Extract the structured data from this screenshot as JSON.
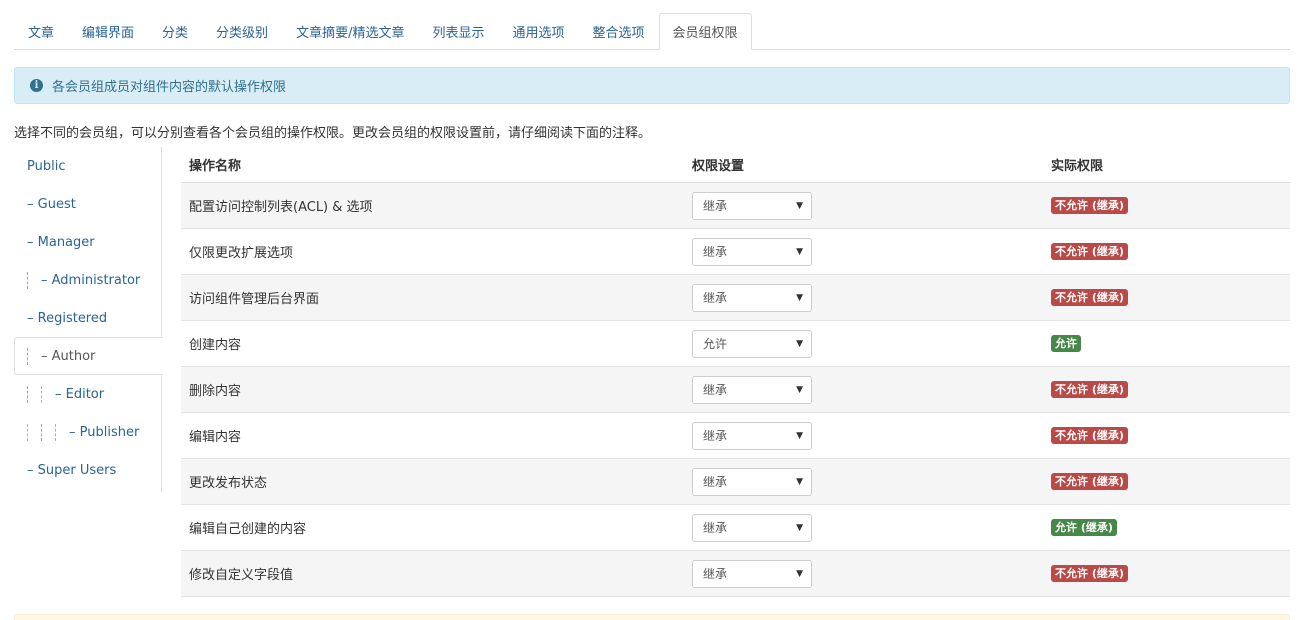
{
  "tabs": [
    "文章",
    "编辑界面",
    "分类",
    "分类级别",
    "文章摘要/精选文章",
    "列表显示",
    "通用选项",
    "整合选项",
    "会员组权限"
  ],
  "active_tab": 8,
  "alert": {
    "icon": "info-icon",
    "text": "各会员组成员对组件内容的默认操作权限"
  },
  "intro": "选择不同的会员组，可以分别查看各个会员组的操作权限。更改会员组的权限设置前，请仔细阅读下面的注释。",
  "groups": [
    "Public",
    "– Guest",
    "– Manager",
    "– Administrator",
    "– Registered",
    "– Author",
    "– Editor",
    "– Publisher",
    "– Super Users"
  ],
  "table": {
    "headers": [
      "操作名称",
      "权限设置",
      "实际权限"
    ],
    "rows": [
      {
        "action": "配置访问控制列表(ACL) & 选项",
        "setting": "继承",
        "result": "不允许 (继承)",
        "status": "deny"
      },
      {
        "action": "仅限更改扩展选项",
        "setting": "继承",
        "result": "不允许 (继承)",
        "status": "deny"
      },
      {
        "action": "访问组件管理后台界面",
        "setting": "继承",
        "result": "不允许 (继承)",
        "status": "deny"
      },
      {
        "action": "创建内容",
        "setting": "允许",
        "result": "允许",
        "status": "allow"
      },
      {
        "action": "删除内容",
        "setting": "继承",
        "result": "不允许 (继承)",
        "status": "deny"
      },
      {
        "action": "编辑内容",
        "setting": "继承",
        "result": "不允许 (继承)",
        "status": "deny"
      },
      {
        "action": "更改发布状态",
        "setting": "继承",
        "result": "不允许 (继承)",
        "status": "deny"
      },
      {
        "action": "编辑自己创建的内容",
        "setting": "继承",
        "result": "允许 (继承)",
        "status": "allow"
      },
      {
        "action": "修改自定义字段值",
        "setting": "继承",
        "result": "不允许 (继承)",
        "status": "deny"
      }
    ]
  },
  "colors": {
    "link": "#2a6496",
    "deny": "#b94a48",
    "allow": "#468847",
    "info_bg": "#d9edf7"
  }
}
